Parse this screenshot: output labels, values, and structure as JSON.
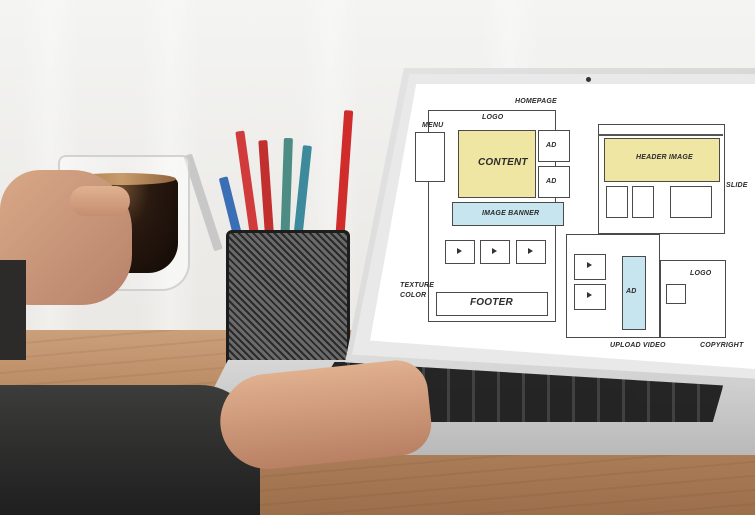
{
  "wireframe": {
    "homepage_title": "HOMEPAGE",
    "logo_label": "LOGO",
    "menu_label": "MENU",
    "content_label": "CONTENT",
    "ad_label_1": "AD",
    "ad_label_2": "AD",
    "image_banner_label": "IMAGE BANNER",
    "footer_label": "FOOTER",
    "header_image_label": "HEADER IMAGE",
    "ad_label_3": "AD",
    "logo_label_2": "LOGO",
    "upload_video_label": "UPLOAD VIDEO",
    "copyright_label": "COPYRIGHT",
    "texture_label": "TEXTURE",
    "color_label": "COLOR",
    "slide_label": "SLIDE"
  },
  "colors": {
    "content_fill": "#f0e6a4",
    "banner_fill": "#c6e5ee",
    "desk": "#b98a63",
    "laptop": "#d7d7d7"
  }
}
